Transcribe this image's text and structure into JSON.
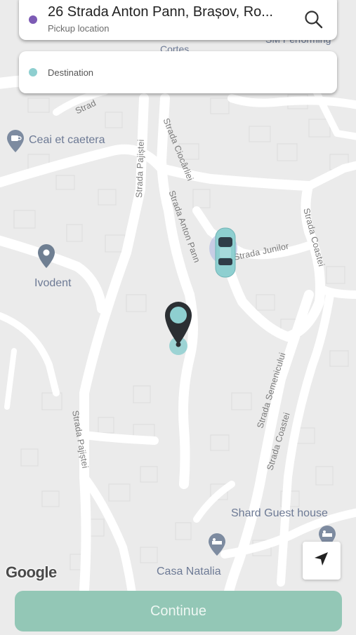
{
  "pickup": {
    "address": "26 Strada Anton Pann, Brașov, Ro...",
    "label": "Pickup location",
    "dot_color": "#7d5bb5"
  },
  "destination": {
    "placeholder": "Destination",
    "dot_color": "#8ecfd0"
  },
  "map": {
    "streets": [
      "Strada Pajiștei",
      "Strada Ciocârliei",
      "Strada Anton Pann",
      "Strada Junilor",
      "Strada Coastei",
      "Strada Semenicului",
      "Strada Coastei",
      "Strada Pajiștei",
      "Strad"
    ],
    "pois": [
      {
        "name": "Ceai et caetera",
        "icon": "coffee-icon"
      },
      {
        "name": "Ivodent",
        "icon": "map-pin-icon"
      },
      {
        "name": "Shard Guest house",
        "icon": "hotel-icon"
      },
      {
        "name": "Casa Natalia",
        "icon": "hotel-icon"
      }
    ],
    "partial_labels": [
      "Cortes...",
      "SM Performing"
    ],
    "attribution": "Google",
    "accent_color": "#8ecfd0",
    "marker_color": "#2b2f33"
  },
  "continue_label": "Continue",
  "continue_color": "#93c7b6"
}
